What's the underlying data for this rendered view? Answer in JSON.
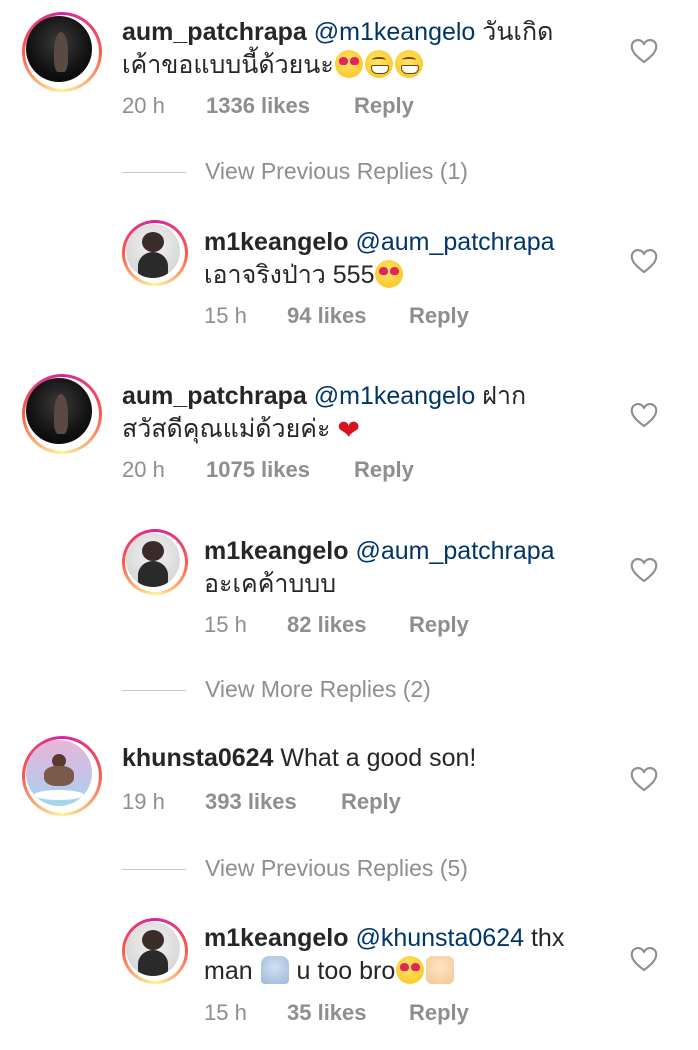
{
  "comments": [
    {
      "username": "aum_patchrapa",
      "mention": "@m1keangelo",
      "text_line1": "วันเกิด",
      "text_line2": "เค้าขอแบบนี้ด้วยนะ",
      "time": "20 h",
      "likes": "1336 likes",
      "reply": "Reply"
    },
    {
      "username": "m1keangelo",
      "mention": "@aum_patchrapa",
      "text_line2": "เอาจริงป่าว 555",
      "time": "15 h",
      "likes": "94 likes",
      "reply": "Reply"
    },
    {
      "username": "aum_patchrapa",
      "mention": "@m1keangelo",
      "text_line1": "ฝาก",
      "text_line2": "สวัสดีคุณแม่ด้วยค่ะ",
      "time": "20 h",
      "likes": "1075 likes",
      "reply": "Reply"
    },
    {
      "username": "m1keangelo",
      "mention": "@aum_patchrapa",
      "text_line2": "อะเคค้าบบบ",
      "time": "15 h",
      "likes": "82 likes",
      "reply": "Reply"
    },
    {
      "username": "khunsta0624",
      "text_line1": "What a good son!",
      "time": "19 h",
      "likes": "393 likes",
      "reply": "Reply"
    },
    {
      "username": "m1keangelo",
      "mention": "@khunsta0624",
      "text_line1": "thx",
      "text_line2a": "man",
      "text_line2b": "u too bro",
      "time": "15 h",
      "likes": "35 likes",
      "reply": "Reply"
    }
  ],
  "view_replies": [
    "View Previous Replies (1)",
    "View More Replies (2)",
    "View Previous Replies (5)"
  ],
  "icons": {
    "like": "heart-outline-icon",
    "emoji_heart_eyes": "smiling-face-heart-eyes",
    "emoji_grin": "grinning-face",
    "emoji_red_heart": "red-heart",
    "emoji_pray": "folded-hands",
    "emoji_thumb": "thumbs-up"
  },
  "colors": {
    "username": "#262626",
    "mention": "#003569",
    "meta": "#8e8e8e",
    "divider": "#c7c7c7"
  }
}
